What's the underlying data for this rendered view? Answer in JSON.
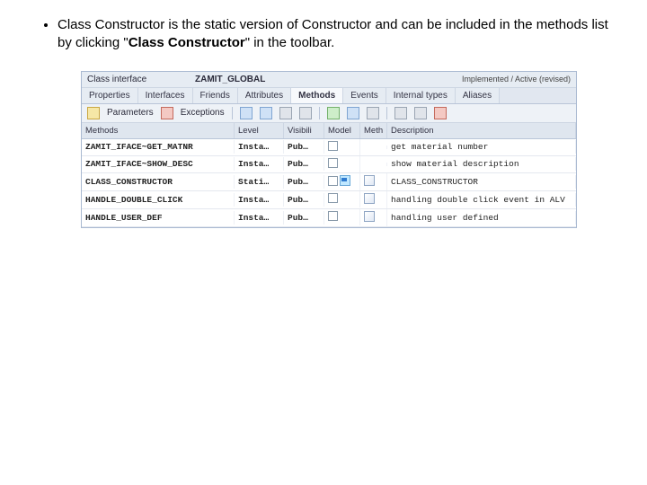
{
  "slide": {
    "bullet_prefix_1": "Class Constructor is the static version of Constructor and can be included in the methods list by clicking \"",
    "bullet_bold": "Class Constructor",
    "bullet_suffix_1": "\" in the toolbar."
  },
  "header": {
    "label": "Class interface",
    "value": "ZAMIT_GLOBAL",
    "status": "Implemented / Active (revised)"
  },
  "tabs": {
    "t0": "Properties",
    "t1": "Interfaces",
    "t2": "Friends",
    "t3": "Attributes",
    "t4": "Methods",
    "t5": "Events",
    "t6": "Internal types",
    "t7": "Aliases"
  },
  "subbar": {
    "btn_params": "Parameters",
    "btn_except": "Exceptions"
  },
  "cols": {
    "method": "Methods",
    "level": "Level",
    "visi": "Visibili",
    "model": "Model",
    "meth": "Meth",
    "desc": "Description"
  },
  "rows": [
    {
      "method": "ZAMIT_IFACE~GET_MATNR",
      "level": "Insta…",
      "visi": "Pub…",
      "model": "",
      "meth": "",
      "desc": "get material number"
    },
    {
      "method": "ZAMIT_IFACE~SHOW_DESC",
      "level": "Insta…",
      "visi": "Pub…",
      "model": "",
      "meth": "",
      "desc": "show material description"
    },
    {
      "method": "CLASS_CONSTRUCTOR",
      "level": "Stati…",
      "visi": "Pub…",
      "model": "flag",
      "meth": "doc",
      "desc": "CLASS_CONSTRUCTOR"
    },
    {
      "method": "HANDLE_DOUBLE_CLICK",
      "level": "Insta…",
      "visi": "Pub…",
      "model": "",
      "meth": "doc",
      "desc": "handling double click event in ALV"
    },
    {
      "method": "HANDLE_USER_DEF",
      "level": "Insta…",
      "visi": "Pub…",
      "model": "",
      "meth": "doc",
      "desc": "handling user defined"
    }
  ]
}
